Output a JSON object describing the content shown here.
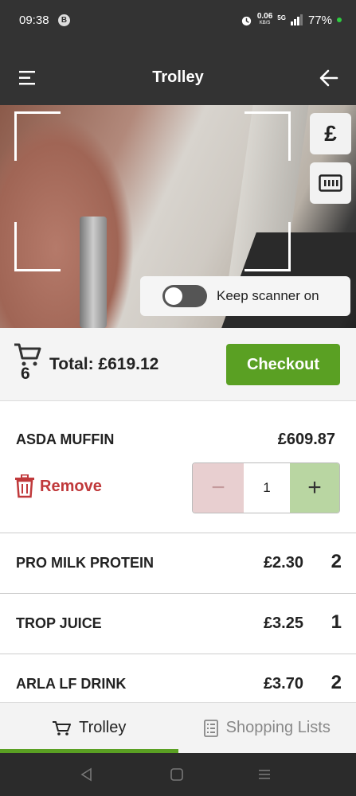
{
  "status_bar": {
    "time": "09:38",
    "badge": "B",
    "speed_value": "0.06",
    "speed_unit": "KB/S",
    "network": "5G",
    "battery": "77%"
  },
  "app_bar": {
    "title": "Trolley",
    "menu_icon": "hamburger-menu-icon",
    "back_icon": "arrow-left-icon"
  },
  "scanner": {
    "currency_label": "£",
    "barcode_icon": "barcode-icon",
    "toggle_label": "Keep scanner on",
    "toggle_on": false
  },
  "summary": {
    "item_count": "6",
    "total_label": "Total: £619.12",
    "checkout_label": "Checkout"
  },
  "items": [
    {
      "name": "ASDA MUFFIN",
      "price": "£609.87",
      "quantity": "1",
      "expanded": true,
      "remove_label": "Remove",
      "minus": "−",
      "plus": "+"
    },
    {
      "name": "PRO MILK PROTEIN",
      "price": "£2.30",
      "quantity": "2"
    },
    {
      "name": "TROP JUICE",
      "price": "£3.25",
      "quantity": "1"
    },
    {
      "name": "ARLA LF DRINK",
      "price": "£3.70",
      "quantity": "2"
    }
  ],
  "tabs": [
    {
      "label": "Trolley",
      "icon": "cart-icon",
      "active": true
    },
    {
      "label": "Shopping Lists",
      "icon": "list-icon",
      "active": false
    }
  ],
  "colors": {
    "accent_green": "#5aa023",
    "remove_red": "#c0393b",
    "bar_dark": "#333333"
  }
}
